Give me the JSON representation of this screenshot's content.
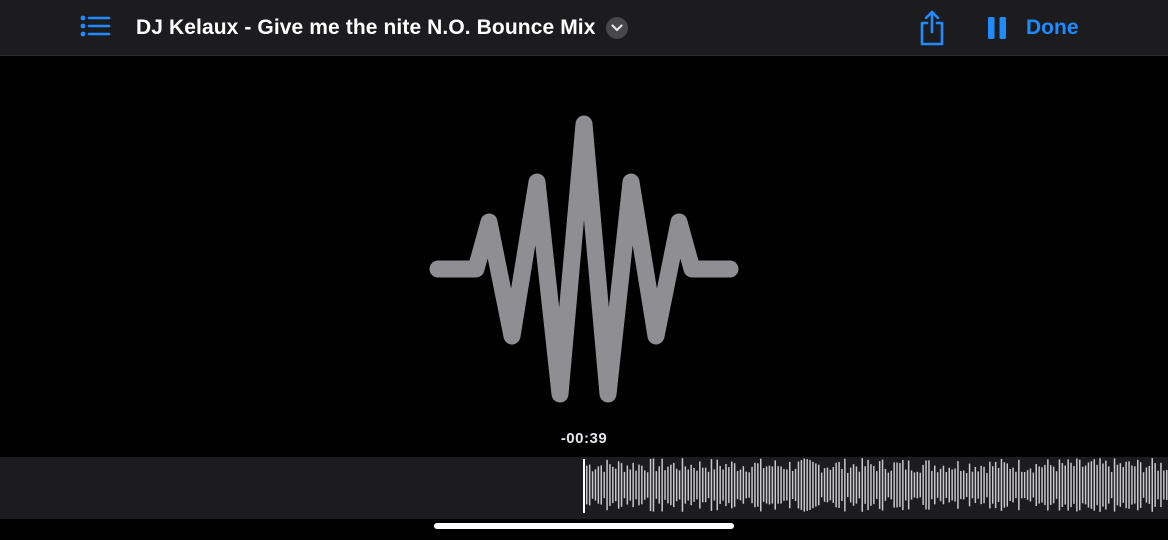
{
  "toolbar": {
    "list_icon": "list-bullet-icon",
    "title": "DJ Kelaux - Give me the nite N.O. Bounce Mix",
    "title_menu_icon": "chevron-down-icon",
    "share_icon": "share-icon",
    "pause_icon": "pause-icon",
    "done_label": "Done"
  },
  "artwork": {
    "icon": "audio-waveform-icon"
  },
  "playback": {
    "remaining_time": "-00:39"
  },
  "colors": {
    "accent": "#1f8bff",
    "toolbar_bg": "#1c1c1e",
    "waveform": "#8e8e93",
    "scrub_bars": "#c7c7cc",
    "background": "#000000"
  }
}
